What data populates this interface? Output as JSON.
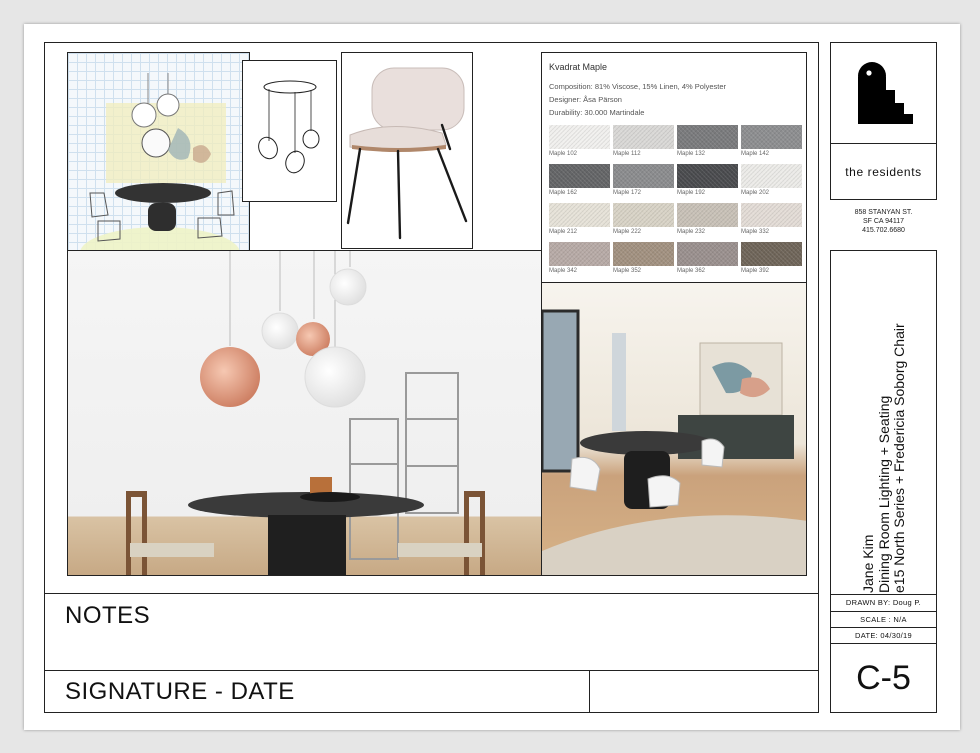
{
  "swatch_card": {
    "title": "Kvadrat Maple",
    "composition": "Composition: 81% Viscose, 15% Linen, 4% Polyester",
    "designer": "Designer: Åsa Pärson",
    "durability": "Durability: 30.000 Martindale",
    "swatches": [
      {
        "label": "Maple 102",
        "color": "#f1f0ee"
      },
      {
        "label": "Maple 112",
        "color": "#d9d8d6"
      },
      {
        "label": "Maple 132",
        "color": "#7a7b7d"
      },
      {
        "label": "Maple 142",
        "color": "#8d8e90"
      },
      {
        "label": "Maple 162",
        "color": "#646567"
      },
      {
        "label": "Maple 172",
        "color": "#8b8c8e"
      },
      {
        "label": "Maple 192",
        "color": "#4a4b4e"
      },
      {
        "label": "Maple 202",
        "color": "#ecebe8"
      },
      {
        "label": "Maple 212",
        "color": "#e6e2d8"
      },
      {
        "label": "Maple 222",
        "color": "#d8d3c6"
      },
      {
        "label": "Maple 232",
        "color": "#c8c1b7"
      },
      {
        "label": "Maple 332",
        "color": "#e3dcd6"
      },
      {
        "label": "Maple 342",
        "color": "#b7aaa6"
      },
      {
        "label": "Maple 352",
        "color": "#a29180"
      },
      {
        "label": "Maple 362",
        "color": "#9a908e"
      },
      {
        "label": "Maple 392",
        "color": "#6f6559"
      }
    ]
  },
  "notes": {
    "title": "NOTES"
  },
  "signature": {
    "title": "SIGNATURE - DATE"
  },
  "title_block": {
    "brand": "the residents",
    "address_line1": "858 STANYAN ST.",
    "address_line2": "SF CA 94117",
    "phone": "415.702.6680",
    "client": "Jane Kim",
    "project": "Dining Room Lighting + Seating",
    "products": "e15 North Series + Fredericia Soborg Chair",
    "drawn_by": "DRAWN BY: Doug P.",
    "scale": "SCALE : N/A",
    "date": "DATE: 04/30/19",
    "sheet_number": "C-5"
  }
}
